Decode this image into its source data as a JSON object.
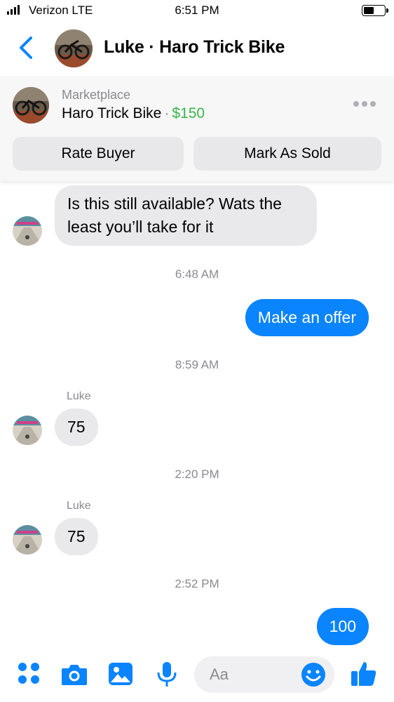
{
  "status_bar": {
    "carrier": "Verizon LTE",
    "time": "6:51 PM",
    "battery_level": 0.45
  },
  "header": {
    "title": "Luke · Haro Trick Bike",
    "back_icon": "chevron-left-icon"
  },
  "listing": {
    "source": "Marketplace",
    "item": "Haro Trick Bike",
    "separator": "·",
    "price": "$150",
    "rate_label": "Rate Buyer",
    "sold_label": "Mark As Sold"
  },
  "messages": [
    {
      "direction": "in",
      "text": "Is this still available? Wats the least you’ll take for it"
    },
    {
      "type": "timestamp",
      "text": "6:48 AM"
    },
    {
      "direction": "out",
      "text": "Make an offer"
    },
    {
      "type": "timestamp",
      "text": "8:59 AM"
    },
    {
      "direction": "in",
      "sender": "Luke",
      "text": "75"
    },
    {
      "type": "timestamp",
      "text": "2:20 PM"
    },
    {
      "direction": "in",
      "sender": "Luke",
      "text": "75"
    },
    {
      "type": "timestamp",
      "text": "2:52 PM"
    },
    {
      "direction": "out",
      "text": "100"
    }
  ],
  "composer": {
    "placeholder": "Aa",
    "icons": [
      "apps-icon",
      "camera-icon",
      "gallery-icon",
      "microphone-icon",
      "emoji-icon",
      "thumbs-up-icon"
    ]
  },
  "colors": {
    "accent": "#0a84ff",
    "price": "#3ab54a",
    "bubble_in": "#e9e9eb",
    "muted": "#8a8a8f"
  }
}
